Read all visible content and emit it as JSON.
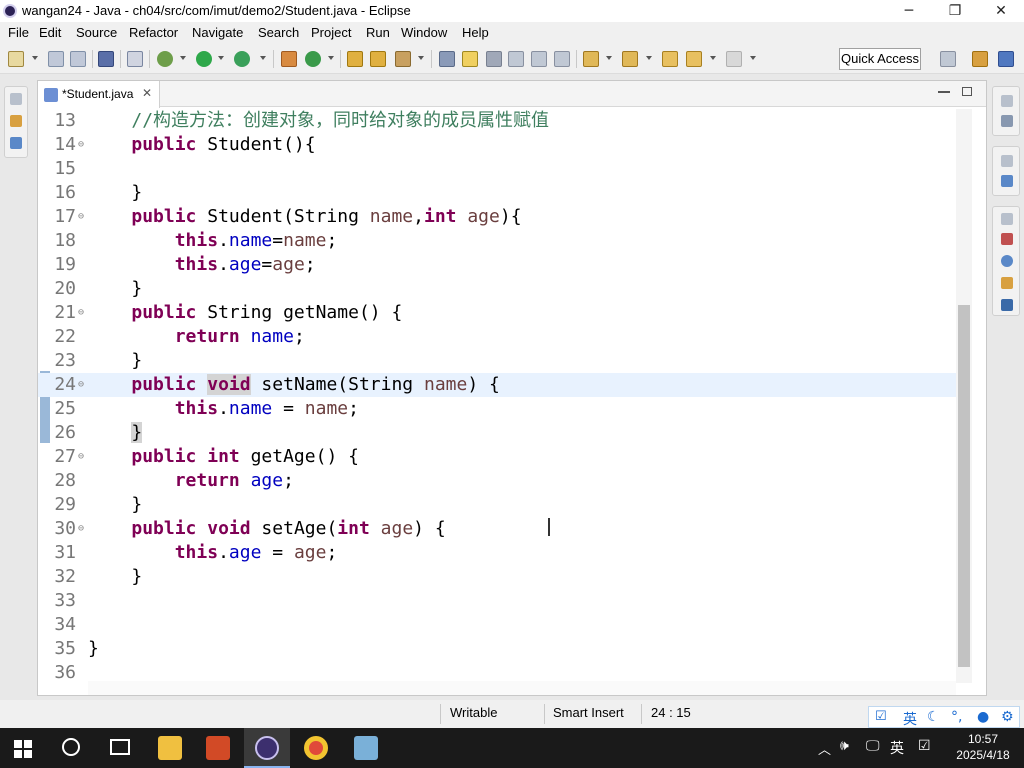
{
  "window": {
    "title": "wangan24 - Java - ch04/src/com/imut/demo2/Student.java - Eclipse",
    "minimize": "─",
    "maximize": "❐",
    "close": "✕"
  },
  "menu": [
    "File",
    "Edit",
    "Source",
    "Refactor",
    "Navigate",
    "Search",
    "Project",
    "Run",
    "Window",
    "Help"
  ],
  "quick_access": "Quick Access",
  "editor": {
    "tab_label": "*Student.java",
    "tab_close": "✕",
    "lines": [
      {
        "num": "13",
        "fold": "",
        "indent": "    ",
        "tokens": [
          [
            "cm",
            "//构造方法：创建对象，同时给对象的成员属性赋值"
          ]
        ]
      },
      {
        "num": "14",
        "fold": "⊖",
        "indent": "    ",
        "tokens": [
          [
            "kw",
            "public"
          ],
          [
            "",
            " Student(){"
          ]
        ]
      },
      {
        "num": "15",
        "fold": "",
        "indent": "",
        "tokens": []
      },
      {
        "num": "16",
        "fold": "",
        "indent": "    ",
        "tokens": [
          [
            "",
            "}"
          ]
        ]
      },
      {
        "num": "17",
        "fold": "⊖",
        "indent": "    ",
        "tokens": [
          [
            "kw",
            "public"
          ],
          [
            "",
            " Student(String "
          ],
          [
            "var",
            "name"
          ],
          [
            "",
            ","
          ],
          [
            "kw",
            "int"
          ],
          [
            "",
            " "
          ],
          [
            "var",
            "age"
          ],
          [
            "",
            "){"
          ]
        ]
      },
      {
        "num": "18",
        "fold": "",
        "indent": "        ",
        "tokens": [
          [
            "kw",
            "this"
          ],
          [
            "",
            "."
          ],
          [
            "fld",
            "name"
          ],
          [
            "",
            "="
          ],
          [
            "var",
            "name"
          ],
          [
            "",
            ";"
          ]
        ]
      },
      {
        "num": "19",
        "fold": "",
        "indent": "        ",
        "tokens": [
          [
            "kw",
            "this"
          ],
          [
            "",
            "."
          ],
          [
            "fld",
            "age"
          ],
          [
            "",
            "="
          ],
          [
            "var",
            "age"
          ],
          [
            "",
            ";"
          ]
        ]
      },
      {
        "num": "20",
        "fold": "",
        "indent": "    ",
        "tokens": [
          [
            "",
            "}"
          ]
        ]
      },
      {
        "num": "21",
        "fold": "⊖",
        "indent": "    ",
        "tokens": [
          [
            "kw",
            "public"
          ],
          [
            "",
            " String getName() {"
          ]
        ]
      },
      {
        "num": "22",
        "fold": "",
        "indent": "        ",
        "tokens": [
          [
            "kw",
            "return"
          ],
          [
            "",
            " "
          ],
          [
            "fld",
            "name"
          ],
          [
            "",
            ";"
          ]
        ]
      },
      {
        "num": "23",
        "fold": "",
        "indent": "    ",
        "tokens": [
          [
            "",
            "}"
          ]
        ]
      },
      {
        "num": "24",
        "fold": "⊖",
        "indent": "    ",
        "current": true,
        "tokens": [
          [
            "kw",
            "public"
          ],
          [
            "",
            " "
          ],
          [
            "kwmark",
            "void"
          ],
          [
            "",
            " setName(String "
          ],
          [
            "var",
            "name"
          ],
          [
            "",
            ") {"
          ]
        ]
      },
      {
        "num": "25",
        "fold": "",
        "indent": "        ",
        "tokens": [
          [
            "kw",
            "this"
          ],
          [
            "",
            "."
          ],
          [
            "fld",
            "name"
          ],
          [
            "",
            " = "
          ],
          [
            "var",
            "name"
          ],
          [
            "",
            ";"
          ]
        ]
      },
      {
        "num": "26",
        "fold": "",
        "indent": "    ",
        "tokens": [
          [
            "mark",
            "}"
          ]
        ]
      },
      {
        "num": "27",
        "fold": "⊖",
        "indent": "    ",
        "tokens": [
          [
            "kw",
            "public"
          ],
          [
            "",
            " "
          ],
          [
            "kw",
            "int"
          ],
          [
            "",
            " getAge() {"
          ]
        ]
      },
      {
        "num": "28",
        "fold": "",
        "indent": "        ",
        "tokens": [
          [
            "kw",
            "return"
          ],
          [
            "",
            " "
          ],
          [
            "fld",
            "age"
          ],
          [
            "",
            ";"
          ]
        ]
      },
      {
        "num": "29",
        "fold": "",
        "indent": "    ",
        "tokens": [
          [
            "",
            "}"
          ]
        ]
      },
      {
        "num": "30",
        "fold": "⊖",
        "indent": "    ",
        "tokens": [
          [
            "kw",
            "public"
          ],
          [
            "",
            " "
          ],
          [
            "kw",
            "void"
          ],
          [
            "",
            " setAge("
          ],
          [
            "kw",
            "int"
          ],
          [
            "",
            " "
          ],
          [
            "var",
            "age"
          ],
          [
            "",
            ") {"
          ]
        ]
      },
      {
        "num": "31",
        "fold": "",
        "indent": "        ",
        "tokens": [
          [
            "kw",
            "this"
          ],
          [
            "",
            "."
          ],
          [
            "fld",
            "age"
          ],
          [
            "",
            " = "
          ],
          [
            "var",
            "age"
          ],
          [
            "",
            ";"
          ]
        ]
      },
      {
        "num": "32",
        "fold": "",
        "indent": "    ",
        "tokens": [
          [
            "",
            "}"
          ]
        ]
      },
      {
        "num": "33",
        "fold": "",
        "indent": "",
        "tokens": []
      },
      {
        "num": "34",
        "fold": "",
        "indent": "",
        "tokens": []
      },
      {
        "num": "35",
        "fold": "",
        "indent": "",
        "tokens": [
          [
            "",
            "}"
          ]
        ]
      },
      {
        "num": "36",
        "fold": "",
        "indent": "",
        "tokens": []
      }
    ]
  },
  "status": {
    "writable": "Writable",
    "insert_mode": "Smart Insert",
    "position": "24 : 15"
  },
  "ime": {
    "lang": "英"
  },
  "tray": {
    "lang": "英",
    "time": "10:57",
    "date": "2025/4/18"
  },
  "colors": {
    "keyword": "#7f0055",
    "field": "#0000c0",
    "variable": "#6a3e3e",
    "comment": "#3f7f5f",
    "current_line": "#e8f2fe"
  }
}
